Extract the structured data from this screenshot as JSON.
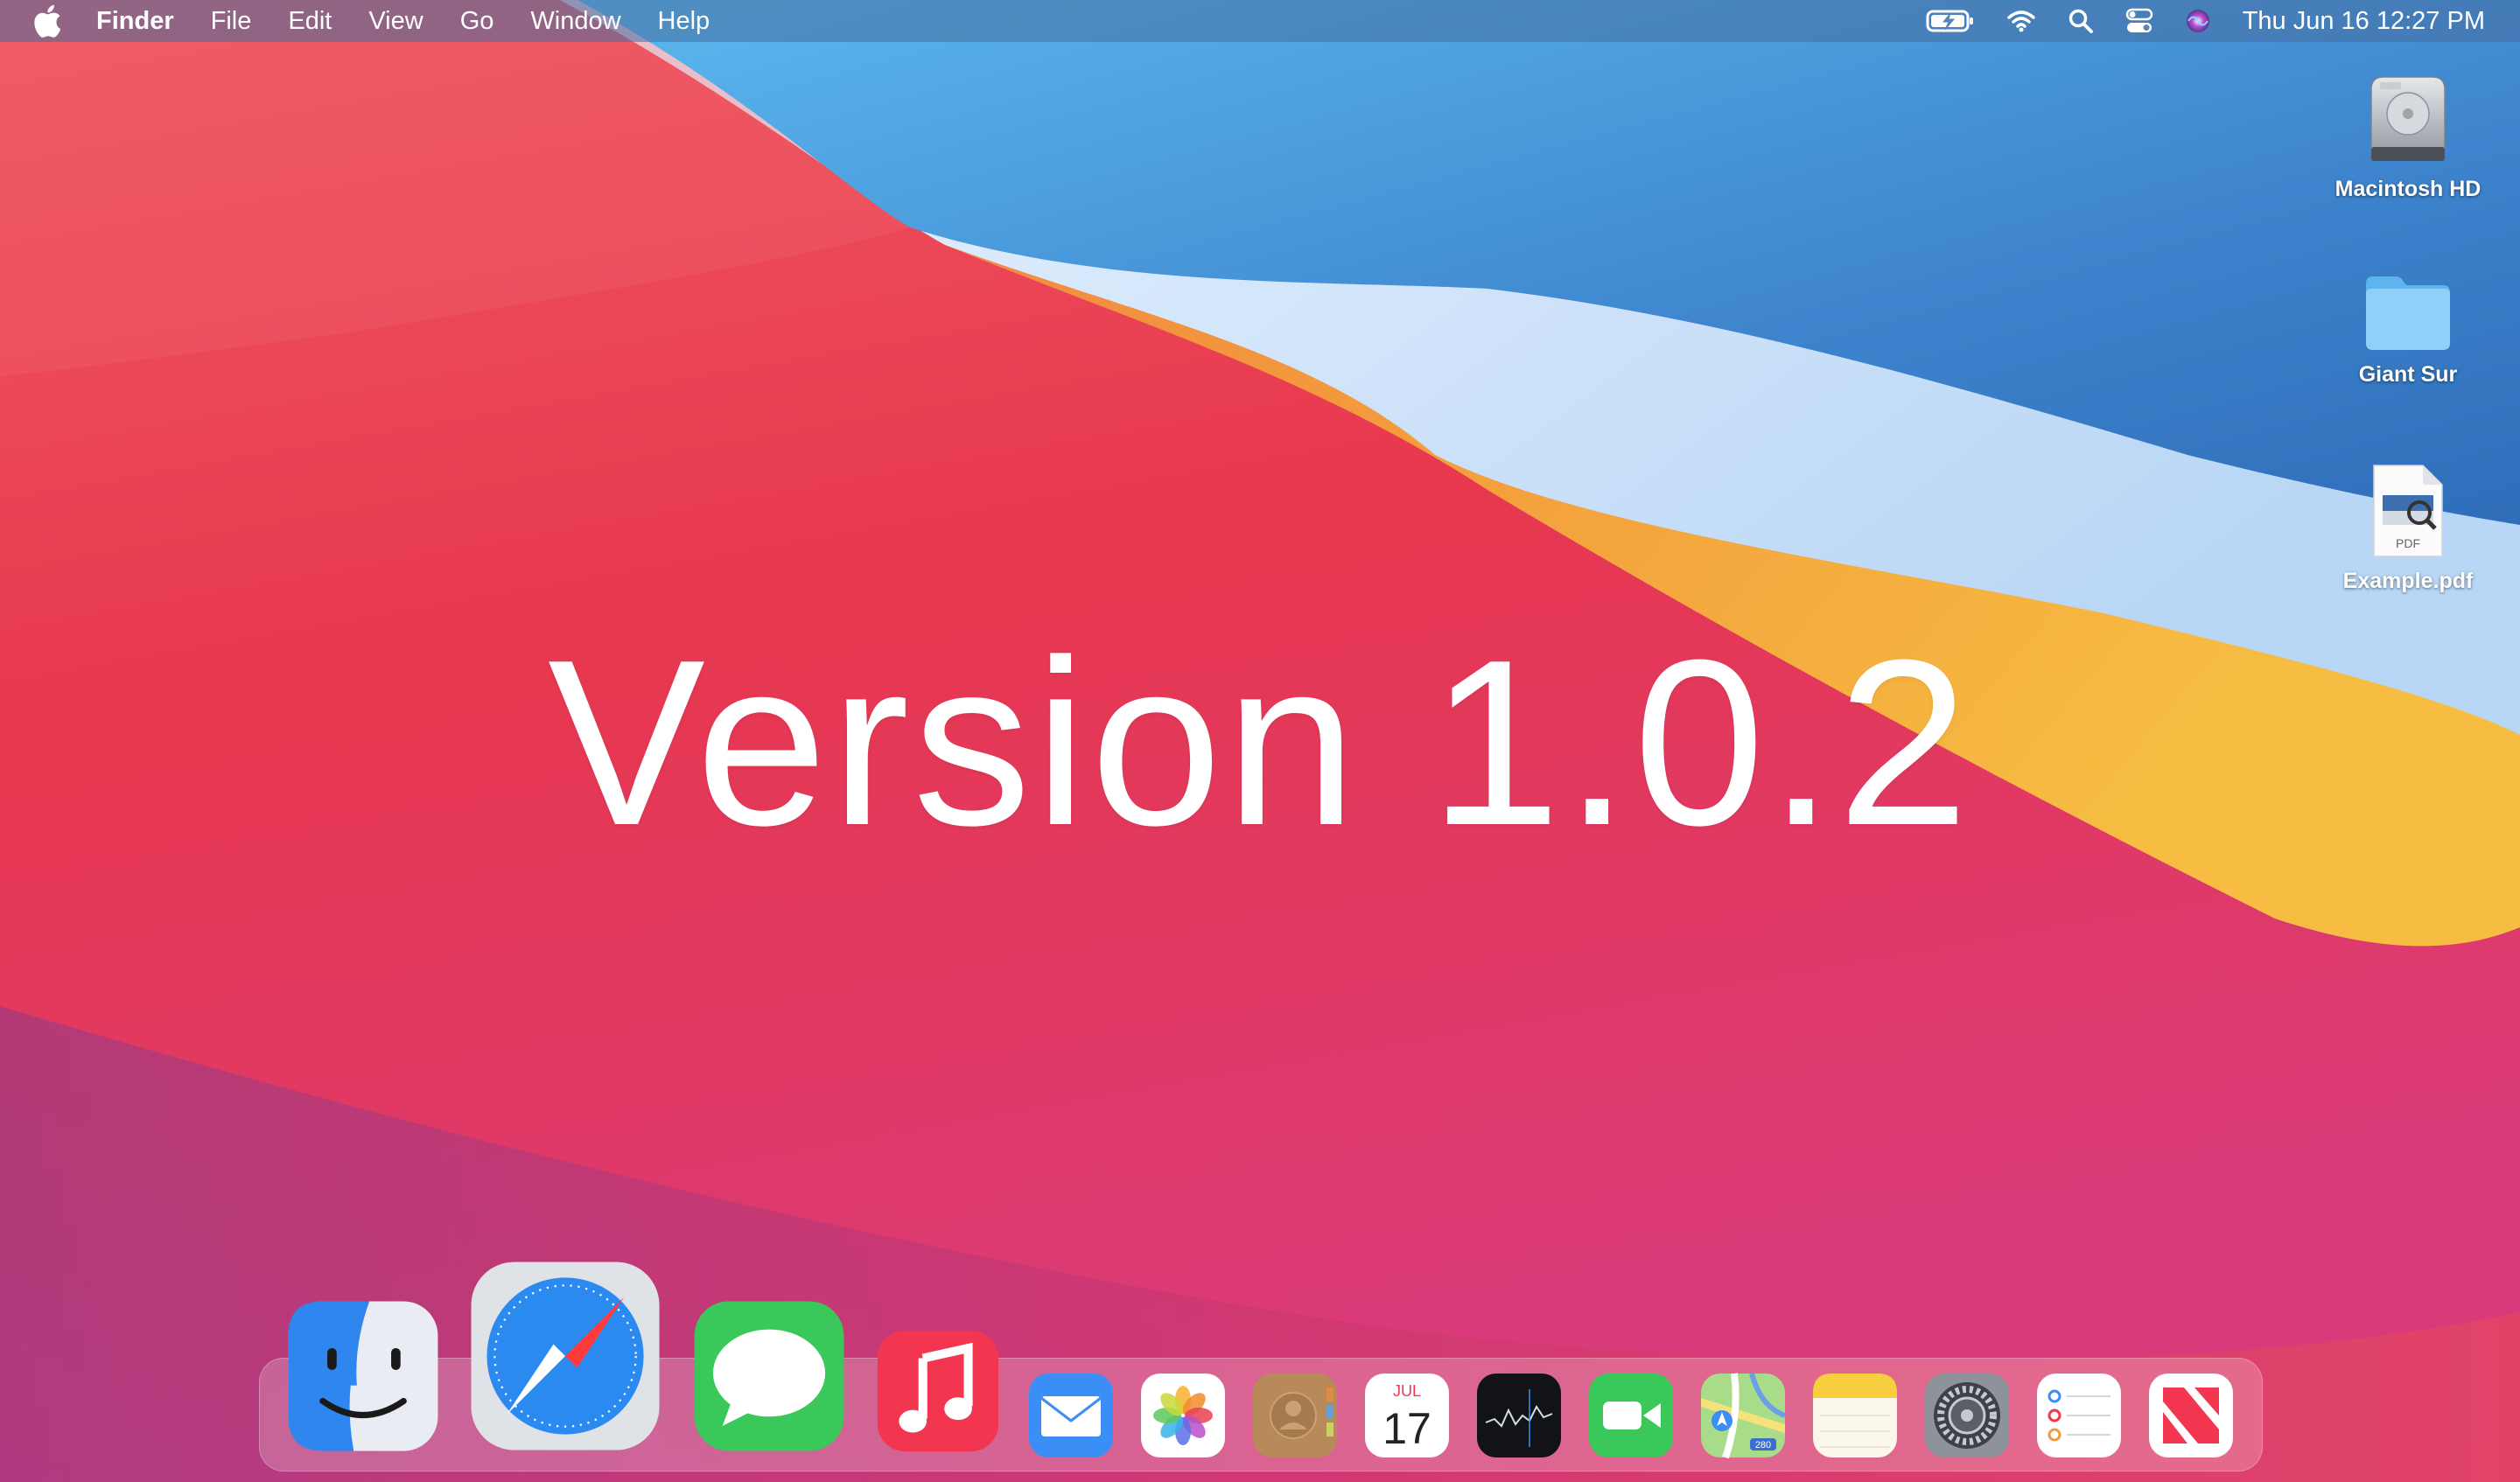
{
  "menubar": {
    "app_name": "Finder",
    "menus": [
      "File",
      "Edit",
      "View",
      "Go",
      "Window",
      "Help"
    ],
    "clock": "Thu Jun 16  12:27 PM",
    "status_icons": [
      "battery-charging-icon",
      "wifi-icon",
      "search-icon",
      "control-center-icon",
      "siri-icon"
    ]
  },
  "desktop": {
    "headline": "Version 1.0.2",
    "icons": [
      {
        "label": "Macintosh HD",
        "icon": "hard-drive-icon"
      },
      {
        "label": "Giant Sur",
        "icon": "folder-icon"
      },
      {
        "label": "Example.pdf",
        "icon": "pdf-file-icon",
        "badge": "PDF"
      }
    ]
  },
  "dock": {
    "apps": [
      "Finder",
      "Safari",
      "Messages",
      "Music",
      "Mail",
      "Photos",
      "Contacts",
      "Calendar",
      "Stocks",
      "FaceTime",
      "Maps",
      "Notes",
      "System Preferences",
      "Reminders",
      "News"
    ],
    "calendar": {
      "month": "JUL",
      "day": "17"
    },
    "maps_badge": "280"
  },
  "colors": {
    "wallpaper_red": "#e8445a",
    "wallpaper_blue": "#3a7fc8",
    "wallpaper_orange": "#f2a43a",
    "menubar": "#5a85b8"
  }
}
